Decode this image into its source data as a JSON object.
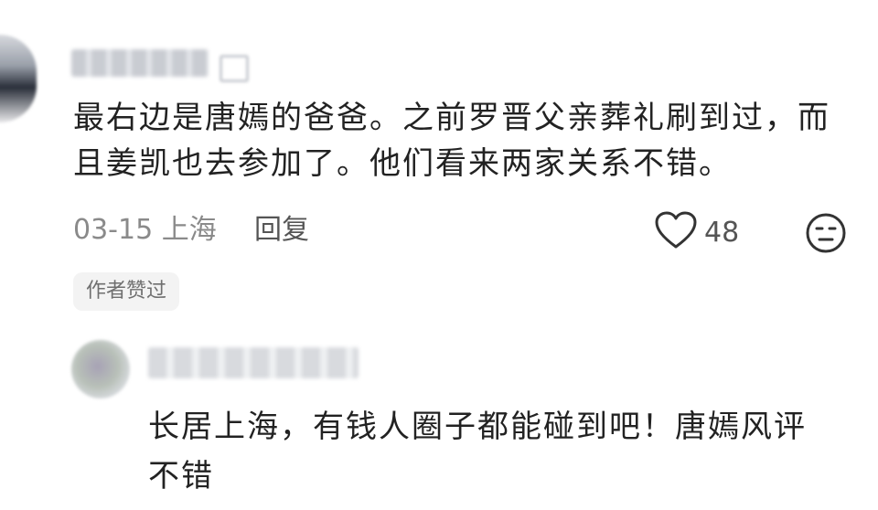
{
  "comment": {
    "text": "最右边是唐嫣的爸爸。之前罗晋父亲葬礼刷到过，而且姜凯也去参加了。他们看来两家关系不错。",
    "date_location": "03-15 上海",
    "reply_label": "回复",
    "like_count": "48",
    "author_liked_label": "作者赞过"
  },
  "reply": {
    "text_line1": "长居上海，有钱人圈子都能碰到吧！唐嫣风评",
    "text_line2": "不错"
  },
  "icons": {
    "like": "heart-outline-icon",
    "emoji": "neutral-face-icon"
  },
  "colors": {
    "text": "#222222",
    "meta": "#8a8a8a",
    "badge_bg": "#f3f3f3"
  }
}
